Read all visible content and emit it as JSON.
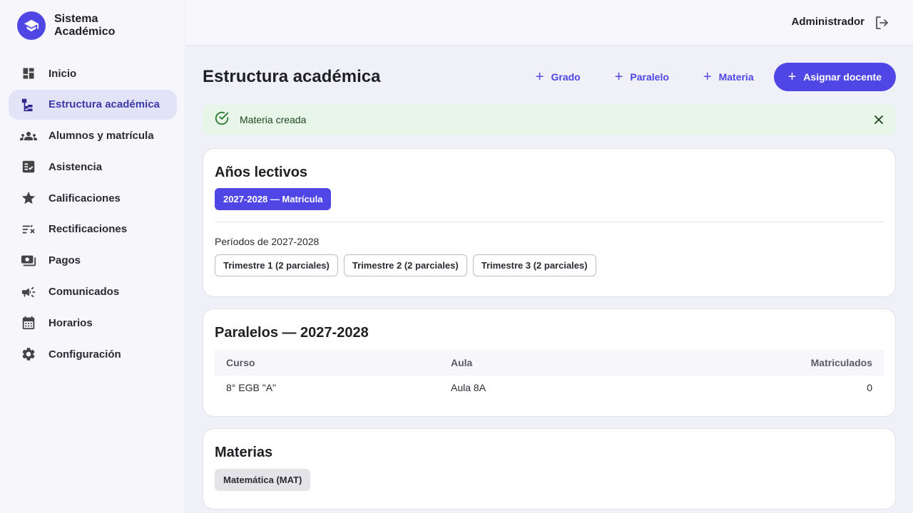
{
  "brand": {
    "name": "Sistema Académico"
  },
  "sidebar": {
    "items": [
      {
        "label": "Inicio",
        "icon": "dashboard-icon",
        "active": false
      },
      {
        "label": "Estructura académica",
        "icon": "hierarchy-icon",
        "active": true
      },
      {
        "label": "Alumnos y matrícula",
        "icon": "people-icon",
        "active": false
      },
      {
        "label": "Asistencia",
        "icon": "checklist-icon",
        "active": false
      },
      {
        "label": "Calificaciones",
        "icon": "star-icon",
        "active": false
      },
      {
        "label": "Rectificaciones",
        "icon": "edit-list-icon",
        "active": false
      },
      {
        "label": "Pagos",
        "icon": "payments-icon",
        "active": false
      },
      {
        "label": "Comunicados",
        "icon": "megaphone-icon",
        "active": false
      },
      {
        "label": "Horarios",
        "icon": "calendar-icon",
        "active": false
      },
      {
        "label": "Configuración",
        "icon": "gear-icon",
        "active": false
      }
    ]
  },
  "topbar": {
    "user": "Administrador"
  },
  "page": {
    "title": "Estructura académica"
  },
  "actions": {
    "grado": "Grado",
    "paralelo": "Paralelo",
    "materia": "Materia",
    "asignar": "Asignar docente"
  },
  "alert": {
    "message": "Materia creada"
  },
  "anios": {
    "title": "Años lectivos",
    "selected": "2027-2028 — Matrícula",
    "periodos_label": "Períodos de 2027-2028",
    "periodos": [
      "Trimestre 1 (2 parciales)",
      "Trimestre 2 (2 parciales)",
      "Trimestre 3 (2 parciales)"
    ]
  },
  "paralelos": {
    "title": "Paralelos — 2027-2028",
    "columns": [
      "Curso",
      "Aula",
      "Matriculados"
    ],
    "rows": [
      {
        "curso": "8° EGB \"A\"",
        "aula": "Aula 8A",
        "matriculados": "0"
      }
    ]
  },
  "materias": {
    "title": "Materias",
    "items": [
      "Matemática (MAT)"
    ]
  },
  "colors": {
    "accent": "#4f46e5",
    "active_bg": "#e3e3f8",
    "success_bg": "#e8f5e9",
    "success": "#2e7d32"
  }
}
